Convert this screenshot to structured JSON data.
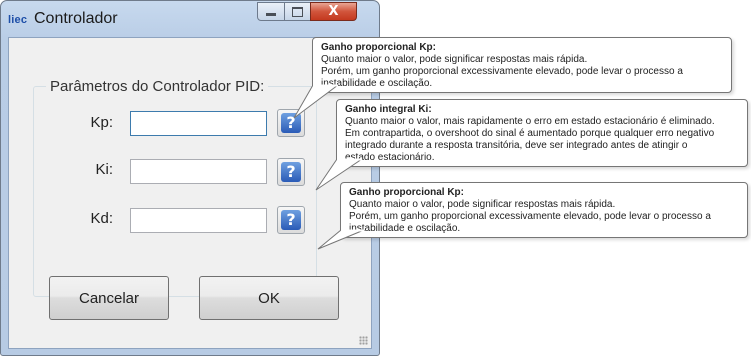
{
  "window": {
    "app_icon": "liec",
    "title": "Controlador",
    "controls": {
      "minimize": "minimize-icon",
      "maximize": "maximize-icon",
      "close": "close-icon",
      "close_glyph": "X"
    },
    "close_color": "#c94a32"
  },
  "group": {
    "legend": "Parâmetros do Controlador PID:",
    "params": [
      {
        "label": "Kp:",
        "value": "",
        "help_glyph": "?"
      },
      {
        "label": "Ki:",
        "value": "",
        "help_glyph": "?"
      },
      {
        "label": "Kd:",
        "value": "",
        "help_glyph": "?"
      }
    ]
  },
  "buttons": {
    "cancel": "Cancelar",
    "ok": "OK"
  },
  "tooltips": [
    {
      "title": "Ganho proporcional Kp:",
      "lines": [
        "Quanto maior o valor, pode significar respostas mais rápida.",
        "Porém, um ganho proporcional excessivamente elevado, pode levar o processo a",
        "instabilidade e oscilação."
      ]
    },
    {
      "title": "Ganho integral Ki:",
      "lines": [
        "Quanto maior o valor, mais rapidamente o erro em estado estacionário é eliminado.",
        "Em contrapartida, o overshoot do sinal é aumentado porque qualquer erro negativo",
        "integrado durante a resposta transitória, deve ser integrado antes de atingir o",
        "estado estacionário."
      ]
    },
    {
      "title": "Ganho proporcional Kp:",
      "lines": [
        "Quanto maior o valor, pode significar respostas mais rápida.",
        "Porém, um ganho proporcional excessivamente elevado, pode levar o processo a",
        "instabilidade e oscilação."
      ]
    }
  ]
}
